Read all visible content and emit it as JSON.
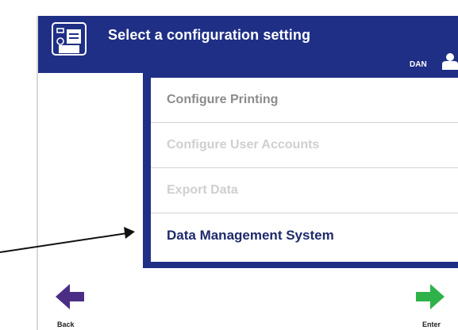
{
  "header": {
    "title": "Select a configuration setting",
    "username": "DAN",
    "icon": "configuration-icon",
    "user_icon": "user-icon",
    "background": "#1f2f86"
  },
  "menu": {
    "items": [
      {
        "label": "Configure Printing",
        "state": "enabled"
      },
      {
        "label": "Configure User Accounts",
        "state": "disabled"
      },
      {
        "label": "Export Data",
        "state": "disabled"
      },
      {
        "label": "Data Management System",
        "state": "selected"
      }
    ]
  },
  "buttons": {
    "back_label": "Back",
    "enter_label": "Enter",
    "back_color": "#4b2d86",
    "enter_color": "#2fb24a"
  }
}
